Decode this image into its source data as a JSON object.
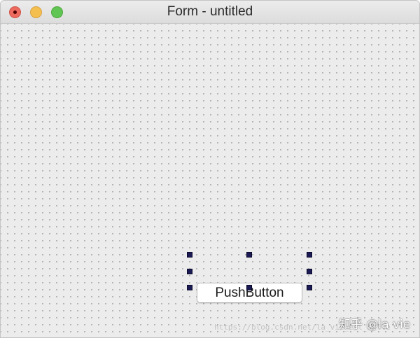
{
  "window": {
    "title": "Form - untitled"
  },
  "form": {
    "push_button_label": "PushButton"
  },
  "watermark": {
    "url_text": "https://blog.csdn.net/la_vie_est_belle",
    "brand_text": "知乎 @la vie"
  },
  "colors": {
    "close": "#ed6a5e",
    "minimize": "#f5bf4f",
    "zoom": "#61c554",
    "selection_handle": "#1b1a55",
    "canvas_background": "#ececec"
  },
  "icons": [
    "close-window-icon",
    "minimize-window-icon",
    "zoom-window-icon"
  ]
}
